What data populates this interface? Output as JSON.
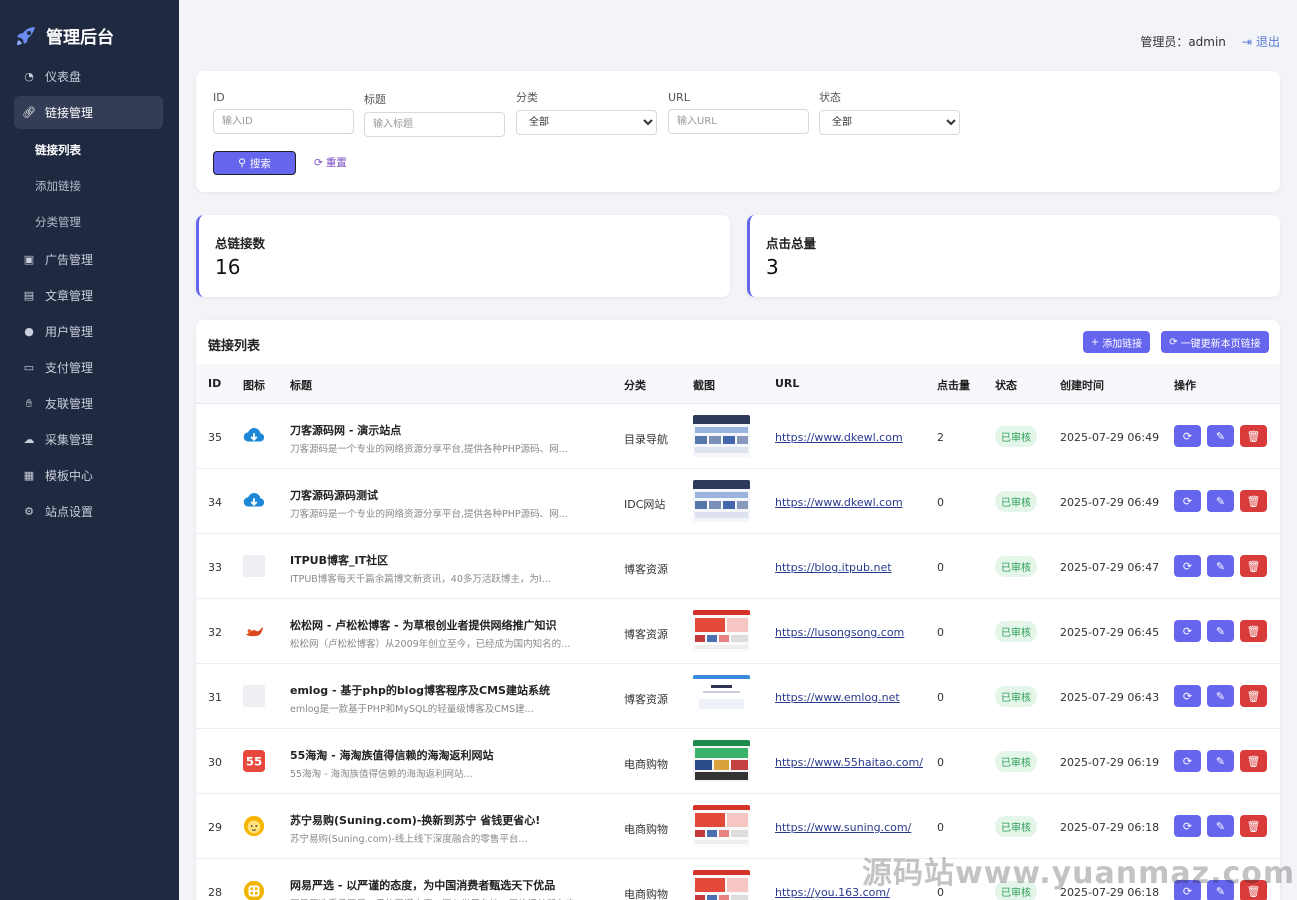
{
  "brand": {
    "title": "管理后台"
  },
  "sidebar": {
    "items": [
      {
        "label": "仪表盘",
        "icon": "dashboard-icon"
      },
      {
        "label": "链接管理",
        "icon": "link-icon"
      },
      {
        "label": "广告管理",
        "icon": "ad-icon"
      },
      {
        "label": "文章管理",
        "icon": "file-icon"
      },
      {
        "label": "用户管理",
        "icon": "user-gear-icon"
      },
      {
        "label": "支付管理",
        "icon": "credit-card-icon"
      },
      {
        "label": "友联管理",
        "icon": "handshake-icon"
      },
      {
        "label": "采集管理",
        "icon": "cloud-download-icon"
      },
      {
        "label": "模板中心",
        "icon": "grid-icon"
      },
      {
        "label": "站点设置",
        "icon": "gear-icon"
      }
    ],
    "sub_items": [
      {
        "label": "链接列表"
      },
      {
        "label": "添加链接"
      },
      {
        "label": "分类管理"
      }
    ]
  },
  "header": {
    "admin_label": "管理员：admin",
    "logout_label": "退出"
  },
  "filter": {
    "id_label": "ID",
    "id_placeholder": "输入ID",
    "title_label": "标题",
    "title_placeholder": "输入标题",
    "category_label": "分类",
    "category_value": "全部",
    "url_label": "URL",
    "url_placeholder": "输入URL",
    "status_label": "状态",
    "status_value": "全部",
    "search_label": "搜索",
    "reset_label": "重置"
  },
  "stats": {
    "total_links_label": "总链接数",
    "total_links_value": "16",
    "total_clicks_label": "点击总量",
    "total_clicks_value": "3"
  },
  "table": {
    "title": "链接列表",
    "add_label": "添加链接",
    "update_label": "一键更新本页链接",
    "columns": [
      "ID",
      "图标",
      "标题",
      "分类",
      "截图",
      "URL",
      "点击量",
      "状态",
      "创建时间",
      "操作"
    ],
    "rows": [
      {
        "id": "35",
        "icon": "cloud-download-icon",
        "title": "刀客源码网 - 演示站点",
        "desc": "刀客源码是一个专业的网络资源分享平台,提供各种PHP源码、网...",
        "category": "目录导航",
        "screenshot": "site-screenshot-dark",
        "url": "https://www.dkewl.com",
        "clicks": "2",
        "status": "已审核",
        "created": "2025-07-29 06:49"
      },
      {
        "id": "34",
        "icon": "cloud-download-icon",
        "title": "刀客源码源码测试",
        "desc": "刀客源码是一个专业的网络资源分享平台,提供各种PHP源码、网...",
        "category": "IDC网站",
        "screenshot": "site-screenshot-dark",
        "url": "https://www.dkewl.com",
        "clicks": "0",
        "status": "已审核",
        "created": "2025-07-29 06:49"
      },
      {
        "id": "33",
        "icon": "placeholder-icon",
        "title": "ITPUB博客_IT社区",
        "desc": "ITPUB博客每天千篇余篇博文新资讯，40多万活跃博主，为I...",
        "category": "博客资源",
        "screenshot": "",
        "url": "https://blog.itpub.net",
        "clicks": "0",
        "status": "已审核",
        "created": "2025-07-29 06:47"
      },
      {
        "id": "32",
        "icon": "squirrel-icon",
        "title": "松松网 - 卢松松博客 - 为草根创业者提供网络推广知识",
        "desc": "松松网（卢松松博客）从2009年创立至今，已经成为国内知名的...",
        "category": "博客资源",
        "screenshot": "site-screenshot-red",
        "url": "https://lusongsong.com",
        "clicks": "0",
        "status": "已审核",
        "created": "2025-07-29 06:45"
      },
      {
        "id": "31",
        "icon": "placeholder-icon",
        "title": "emlog - 基于php的blog博客程序及CMS建站系统",
        "desc": "emlog是一款基于PHP和MySQL的轻量级博客及CMS建...",
        "category": "博客资源",
        "screenshot": "site-screenshot-light",
        "url": "https://www.emlog.net",
        "clicks": "0",
        "status": "已审核",
        "created": "2025-07-29 06:43"
      },
      {
        "id": "30",
        "icon": "55-logo-icon",
        "title": "55海淘 - 海淘族值得信赖的海淘返利网站",
        "desc": "55海淘 - 海淘族值得信赖的海淘返利网站...",
        "category": "电商购物",
        "screenshot": "site-screenshot-green",
        "url": "https://www.55haitao.com/",
        "clicks": "0",
        "status": "已审核",
        "created": "2025-07-29 06:19"
      },
      {
        "id": "29",
        "icon": "suning-lion-icon",
        "title": "苏宁易购(Suning.com)-换新到苏宁 省钱更省心!",
        "desc": "苏宁易购(Suning.com)-线上线下深度融合的零售平台...",
        "category": "电商购物",
        "screenshot": "site-screenshot-red",
        "url": "https://www.suning.com/",
        "clicks": "0",
        "status": "已审核",
        "created": "2025-07-29 06:18"
      },
      {
        "id": "28",
        "icon": "yanxuan-icon",
        "title": "网易严选 - 以严谨的态度，为中国消费者甄选天下优品",
        "desc": "网易严选秉承网易一贯的严谨态度，深入世界各地，严格把关所有商...",
        "category": "电商购物",
        "screenshot": "site-screenshot-red",
        "url": "https://you.163.com/",
        "clicks": "0",
        "status": "已审核",
        "created": "2025-07-29 06:18"
      }
    ]
  },
  "watermark": "源码站www.yuanmaz.com",
  "colors": {
    "sidebar_bg": "#1f2940",
    "accent": "#6665ee",
    "danger": "#d93a3a",
    "status_green": "#2a9d55"
  }
}
